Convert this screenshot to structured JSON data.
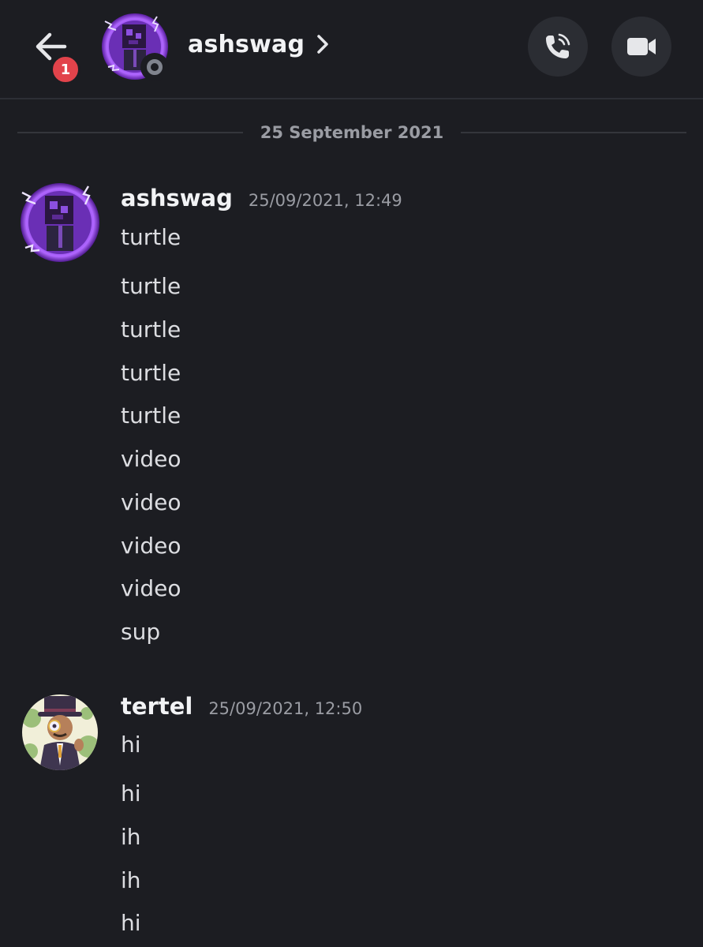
{
  "header": {
    "title": "ashswag",
    "unread_badge": "1",
    "icons": {
      "back": "back-arrow-icon",
      "chevron": "chevron-right-icon",
      "call": "phone-call-icon",
      "video": "video-camera-icon",
      "status": "offline-status-icon"
    }
  },
  "date_divider": {
    "label": "25 September 2021"
  },
  "messages": [
    {
      "author": "ashswag",
      "timestamp": "25/09/2021, 12:49",
      "lines": [
        "turtle",
        "turtle",
        "turtle",
        "turtle",
        "turtle",
        "video",
        "video",
        "video",
        "video",
        "sup"
      ]
    },
    {
      "author": "tertel",
      "timestamp": "25/09/2021, 12:50",
      "lines": [
        "hi",
        "hi",
        "ih",
        "ih",
        "hi"
      ]
    }
  ],
  "colors": {
    "background": "#1c1d22",
    "badge": "#e2434b",
    "button_bg": "#2b2d33",
    "accent_purple": "#7d3cc8"
  }
}
